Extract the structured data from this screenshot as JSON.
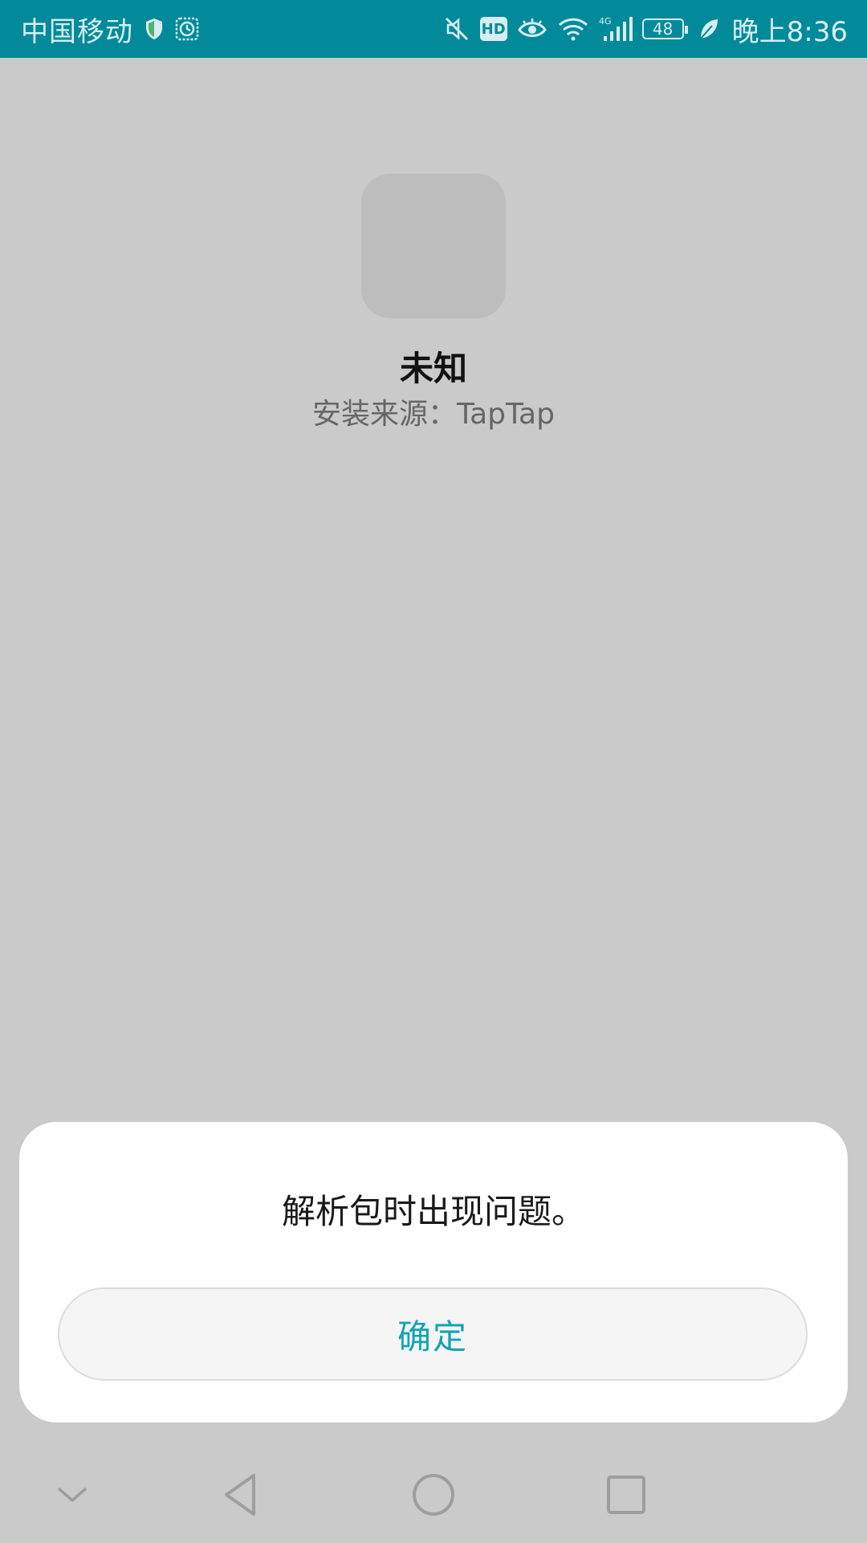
{
  "status_bar": {
    "carrier": "中国移动",
    "network": "4G",
    "battery": "48",
    "time": "晚上8:36",
    "hd_label": "HD",
    "bg_color": "#028a9a"
  },
  "app": {
    "name": "未知",
    "install_source": "安装来源：TapTap"
  },
  "dialog": {
    "message": "解析包时出现问题。",
    "confirm_label": "确定",
    "accent_color": "#15a3b3"
  },
  "nav_bar": {
    "icons": [
      "chevron-down-icon",
      "back-icon",
      "home-icon",
      "recents-icon"
    ]
  }
}
